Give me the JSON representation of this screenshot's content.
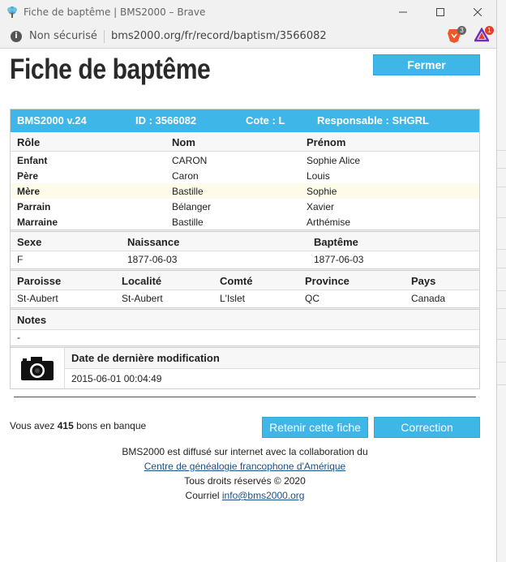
{
  "window": {
    "title": "Fiche de baptême | BMS2000 – Brave",
    "minimize": "—",
    "maximize": "☐",
    "close": "✕"
  },
  "address": {
    "security_label": "Non sécurisé",
    "url": "bms2000.org/fr/record/baptism/3566082",
    "brave_badge": "3",
    "rewards_badge": "1"
  },
  "page": {
    "title": "Fiche de baptême",
    "close_button": "Fermer"
  },
  "record": {
    "version": "BMS2000 v.24",
    "id": "ID : 3566082",
    "cote": "Cote : L",
    "responsable": "Responsable : SHGRL",
    "people_headers": [
      "Rôle",
      "Nom",
      "Prénom"
    ],
    "people": [
      {
        "role": "Enfant",
        "nom": "CARON",
        "prenom": "Sophie Alice"
      },
      {
        "role": "Père",
        "nom": "Caron",
        "prenom": "Louis"
      },
      {
        "role": "Mère",
        "nom": "Bastille",
        "prenom": "Sophie"
      },
      {
        "role": "Parrain",
        "nom": "Bélanger",
        "prenom": "Xavier"
      },
      {
        "role": "Marraine",
        "nom": "Bastille",
        "prenom": "Arthémise"
      }
    ],
    "event_headers": [
      "Sexe",
      "Naissance",
      "Baptême"
    ],
    "event_values": [
      "F",
      "1877-06-03",
      "1877-06-03"
    ],
    "place_headers": [
      "Paroisse",
      "Localité",
      "Comté",
      "Province",
      "Pays"
    ],
    "place_values": [
      "St-Aubert",
      "St-Aubert",
      "L'Islet",
      "QC",
      "Canada"
    ],
    "notes_header": "Notes",
    "notes_value": "-",
    "modified_header": "Date de dernière modification",
    "modified_value": "2015-06-01 00:04:49"
  },
  "actions": {
    "credit_prefix": "Vous avez ",
    "credit_count": "415",
    "credit_suffix": " bons en banque",
    "save_button": "Retenir cette fiche",
    "correction_button": "Correction"
  },
  "footer": {
    "line1": "BMS2000 est diffusé sur internet avec la collaboration du",
    "link1": "Centre de généalogie francophone d'Amérique",
    "line3": "Tous droits réservés © 2020",
    "line4_prefix": "Courriel ",
    "email": "info@bms2000.org"
  },
  "colors": {
    "accent": "#3fb6e8",
    "highlight_row": "#fefbea"
  }
}
